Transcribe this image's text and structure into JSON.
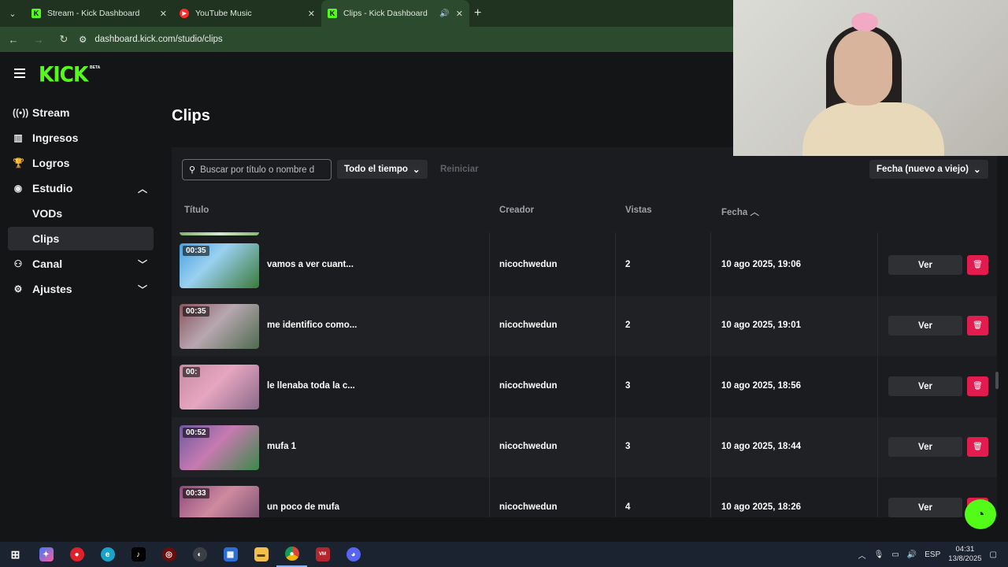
{
  "browser": {
    "tabs": [
      {
        "title": "Stream - Kick Dashboard",
        "favicon": "kick-icon",
        "active": false
      },
      {
        "title": "YouTube Music",
        "favicon": "youtube-music-icon",
        "active": false
      },
      {
        "title": "Clips - Kick Dashboard",
        "favicon": "kick-icon",
        "active": true
      }
    ],
    "url": "dashboard.kick.com/studio/clips"
  },
  "brand": {
    "logo": "KICK",
    "badge": "BETA",
    "accent": "#53fc18"
  },
  "sidebar": {
    "items": [
      {
        "label": "Stream",
        "icon": "broadcast-icon"
      },
      {
        "label": "Ingresos",
        "icon": "chart-icon"
      },
      {
        "label": "Logros",
        "icon": "trophy-icon"
      },
      {
        "label": "Estudio",
        "icon": "studio-icon",
        "expanded": true
      },
      {
        "label": "VODs",
        "sub": true
      },
      {
        "label": "Clips",
        "sub": true,
        "active": true
      },
      {
        "label": "Canal",
        "icon": "channel-icon",
        "expanded": false
      },
      {
        "label": "Ajustes",
        "icon": "gear-icon",
        "expanded": false
      }
    ]
  },
  "main": {
    "title": "Clips",
    "search_placeholder": "Buscar por título o nombre d",
    "time_filter": "Todo el tiempo",
    "reset_label": "Reiniciar",
    "sort_label": "Fecha (nuevo a viejo)",
    "columns": [
      "Título",
      "Creador",
      "Vistas",
      "Fecha"
    ],
    "view_label": "Ver",
    "clips": [
      {
        "duration": "00:35",
        "title": "vamos a ver cuant...",
        "creator": "nicochwedun",
        "views": "2",
        "date": "10 ago 2025, 19:06"
      },
      {
        "duration": "00:35",
        "title": "me identifico como...",
        "creator": "nicochwedun",
        "views": "2",
        "date": "10 ago 2025, 19:01"
      },
      {
        "duration": "00:",
        "title": "le llenaba toda la c...",
        "creator": "nicochwedun",
        "views": "3",
        "date": "10 ago 2025, 18:56"
      },
      {
        "duration": "00:52",
        "title": "mufa 1",
        "creator": "nicochwedun",
        "views": "3",
        "date": "10 ago 2025, 18:44"
      },
      {
        "duration": "00:33",
        "title": "un poco de mufa",
        "creator": "nicochwedun",
        "views": "4",
        "date": "10 ago 2025, 18:26"
      }
    ]
  },
  "taskbar": {
    "lang": "ESP",
    "time": "04:31",
    "date": "13/8/2025"
  }
}
